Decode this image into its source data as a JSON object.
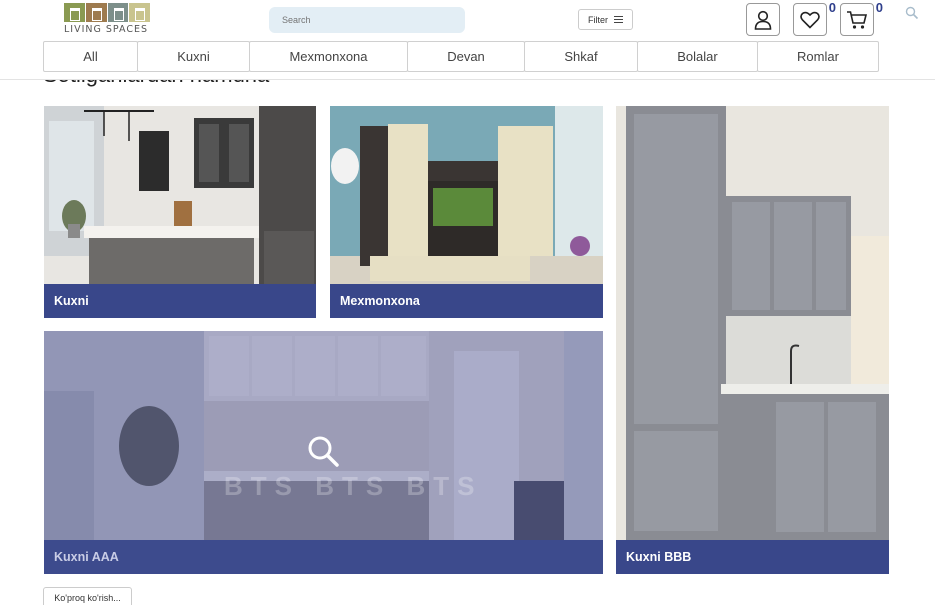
{
  "header": {
    "logo_text": "LIVING SPACES",
    "search": {
      "placeholder": "Search"
    },
    "filter_label": "Filter",
    "wishlist_count": "0",
    "cart_count": "0"
  },
  "nav": {
    "tabs": [
      {
        "label": "All"
      },
      {
        "label": "Kuxni"
      },
      {
        "label": "Mexmonxona"
      },
      {
        "label": "Devan"
      },
      {
        "label": "Shkaf"
      },
      {
        "label": "Bolalar"
      },
      {
        "label": "Romlar"
      }
    ]
  },
  "section_title": "Sotilganlardan namuna",
  "cards": [
    {
      "label": "Kuxni"
    },
    {
      "label": "Mexmonxona"
    },
    {
      "label": "Kuxni BBB"
    },
    {
      "label": "Kuxni AAA"
    }
  ],
  "watermark": "BTS BTS BTS",
  "more_label": "Ko'proq ko'rish...",
  "colors": {
    "accent": "#39478a",
    "badge": "#2f3f8c",
    "search_bg": "#e3eef5"
  }
}
